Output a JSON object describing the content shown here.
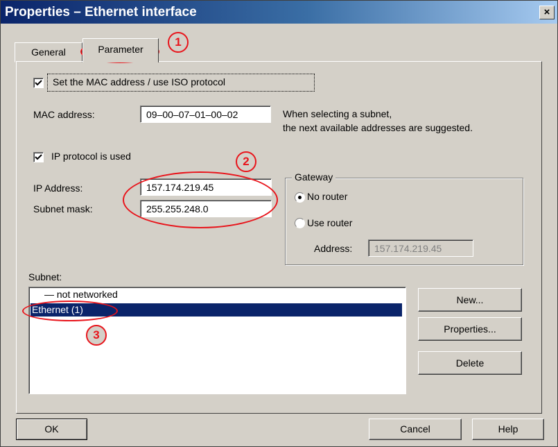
{
  "window": {
    "title": "Properties – Ethernet interface",
    "close_label": "×"
  },
  "tabs": [
    {
      "label": "General",
      "active": false
    },
    {
      "label": "Parameter",
      "active": true
    }
  ],
  "mac_section": {
    "checkbox_label": "Set the MAC address / use ISO protocol",
    "checked": true,
    "mac_label": "MAC address:",
    "mac_value": "09–00–07–01–00–02",
    "hint_line1": "When selecting a subnet,",
    "hint_line2": "the next available addresses are suggested."
  },
  "ip_section": {
    "checkbox_label": "IP protocol is used",
    "checked": true,
    "ip_label": "IP Address:",
    "ip_value": "157.174.219.45",
    "mask_label": "Subnet mask:",
    "mask_value": "255.255.248.0"
  },
  "gateway": {
    "title": "Gateway",
    "no_router_label": "No router",
    "use_router_label": "Use router",
    "selected": "No router",
    "address_label": "Address:",
    "address_value": "157.174.219.45"
  },
  "subnet": {
    "label": "Subnet:",
    "items": [
      {
        "label": "— not networked",
        "selected": false
      },
      {
        "label": "Ethernet (1)",
        "selected": true
      }
    ],
    "buttons": {
      "new": "New...",
      "properties": "Properties...",
      "delete": "Delete"
    }
  },
  "footer": {
    "ok": "OK",
    "cancel": "Cancel",
    "help": "Help"
  },
  "annotations": [
    "1",
    "2",
    "3"
  ],
  "colors": {
    "title_start": "#0a246a",
    "highlight": "#e8141b",
    "selection": "#0a246a",
    "dialog_bg": "#d4d0c8"
  }
}
